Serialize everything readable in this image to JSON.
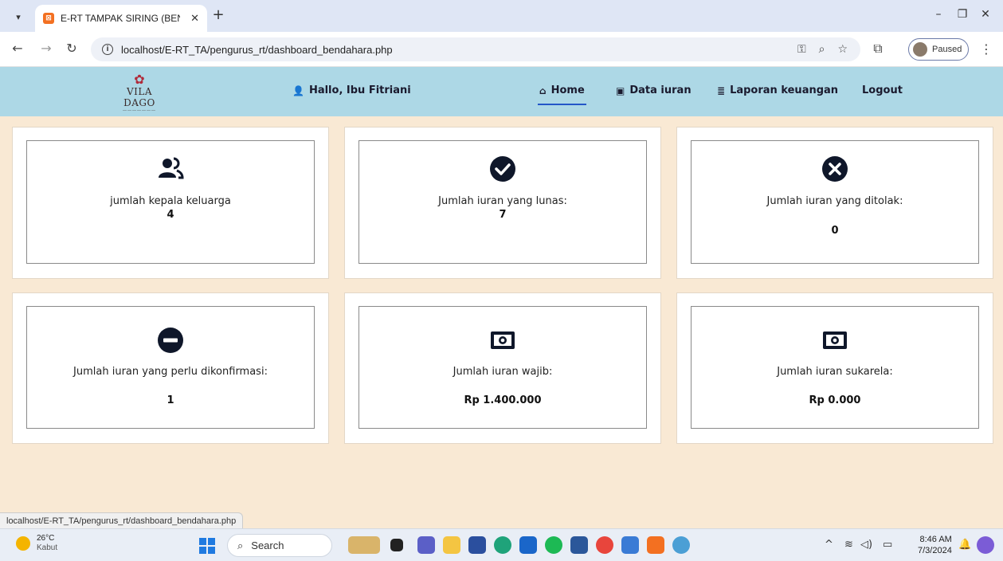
{
  "browser": {
    "tab_title": "E-RT TAMPAK SIRING (BENDAH",
    "url": "localhost/E-RT_TA/pengurus_rt/dashboard_bendahara.php",
    "profile_status": "Paused",
    "status_url": "localhost/E-RT_TA/pengurus_rt/dashboard_bendahara.php"
  },
  "navbar": {
    "logo_text": "VILA DAGO",
    "greeting": "Hallo, Ibu Fitriani",
    "items": [
      {
        "label": "Home",
        "icon": "home-icon",
        "active": true
      },
      {
        "label": "Data iuran",
        "icon": "money-icon",
        "active": false
      },
      {
        "label": "Laporan keuangan",
        "icon": "database-icon",
        "active": false
      },
      {
        "label": "Logout",
        "icon": "",
        "active": false
      }
    ]
  },
  "cards": [
    {
      "icon": "users-icon",
      "label": "jumlah kepala keluarga",
      "value": "4"
    },
    {
      "icon": "check-circle-icon",
      "label": "Jumlah iuran yang lunas:",
      "value": "7"
    },
    {
      "icon": "x-circle-icon",
      "label": "Jumlah iuran yang ditolak:",
      "value": "0"
    },
    {
      "icon": "minus-circle-icon",
      "label": "Jumlah iuran yang perlu dikonfirmasi:",
      "value": "1"
    },
    {
      "icon": "money-bill-icon",
      "label": "Jumlah iuran wajib:",
      "value": "Rp 1.400.000"
    },
    {
      "icon": "money-bill-icon",
      "label": "Jumlah iuran sukarela:",
      "value": "Rp 0.000"
    }
  ],
  "taskbar": {
    "weather_temp": "26°C",
    "weather_desc": "Kabut",
    "search_placeholder": "Search",
    "time": "8:46 AM",
    "date": "7/3/2024"
  },
  "colors": {
    "navbar_bg": "#add8e6",
    "page_bg": "#f9e9d4",
    "active_underline": "#2456c8",
    "icon_dark": "#0f172a"
  }
}
